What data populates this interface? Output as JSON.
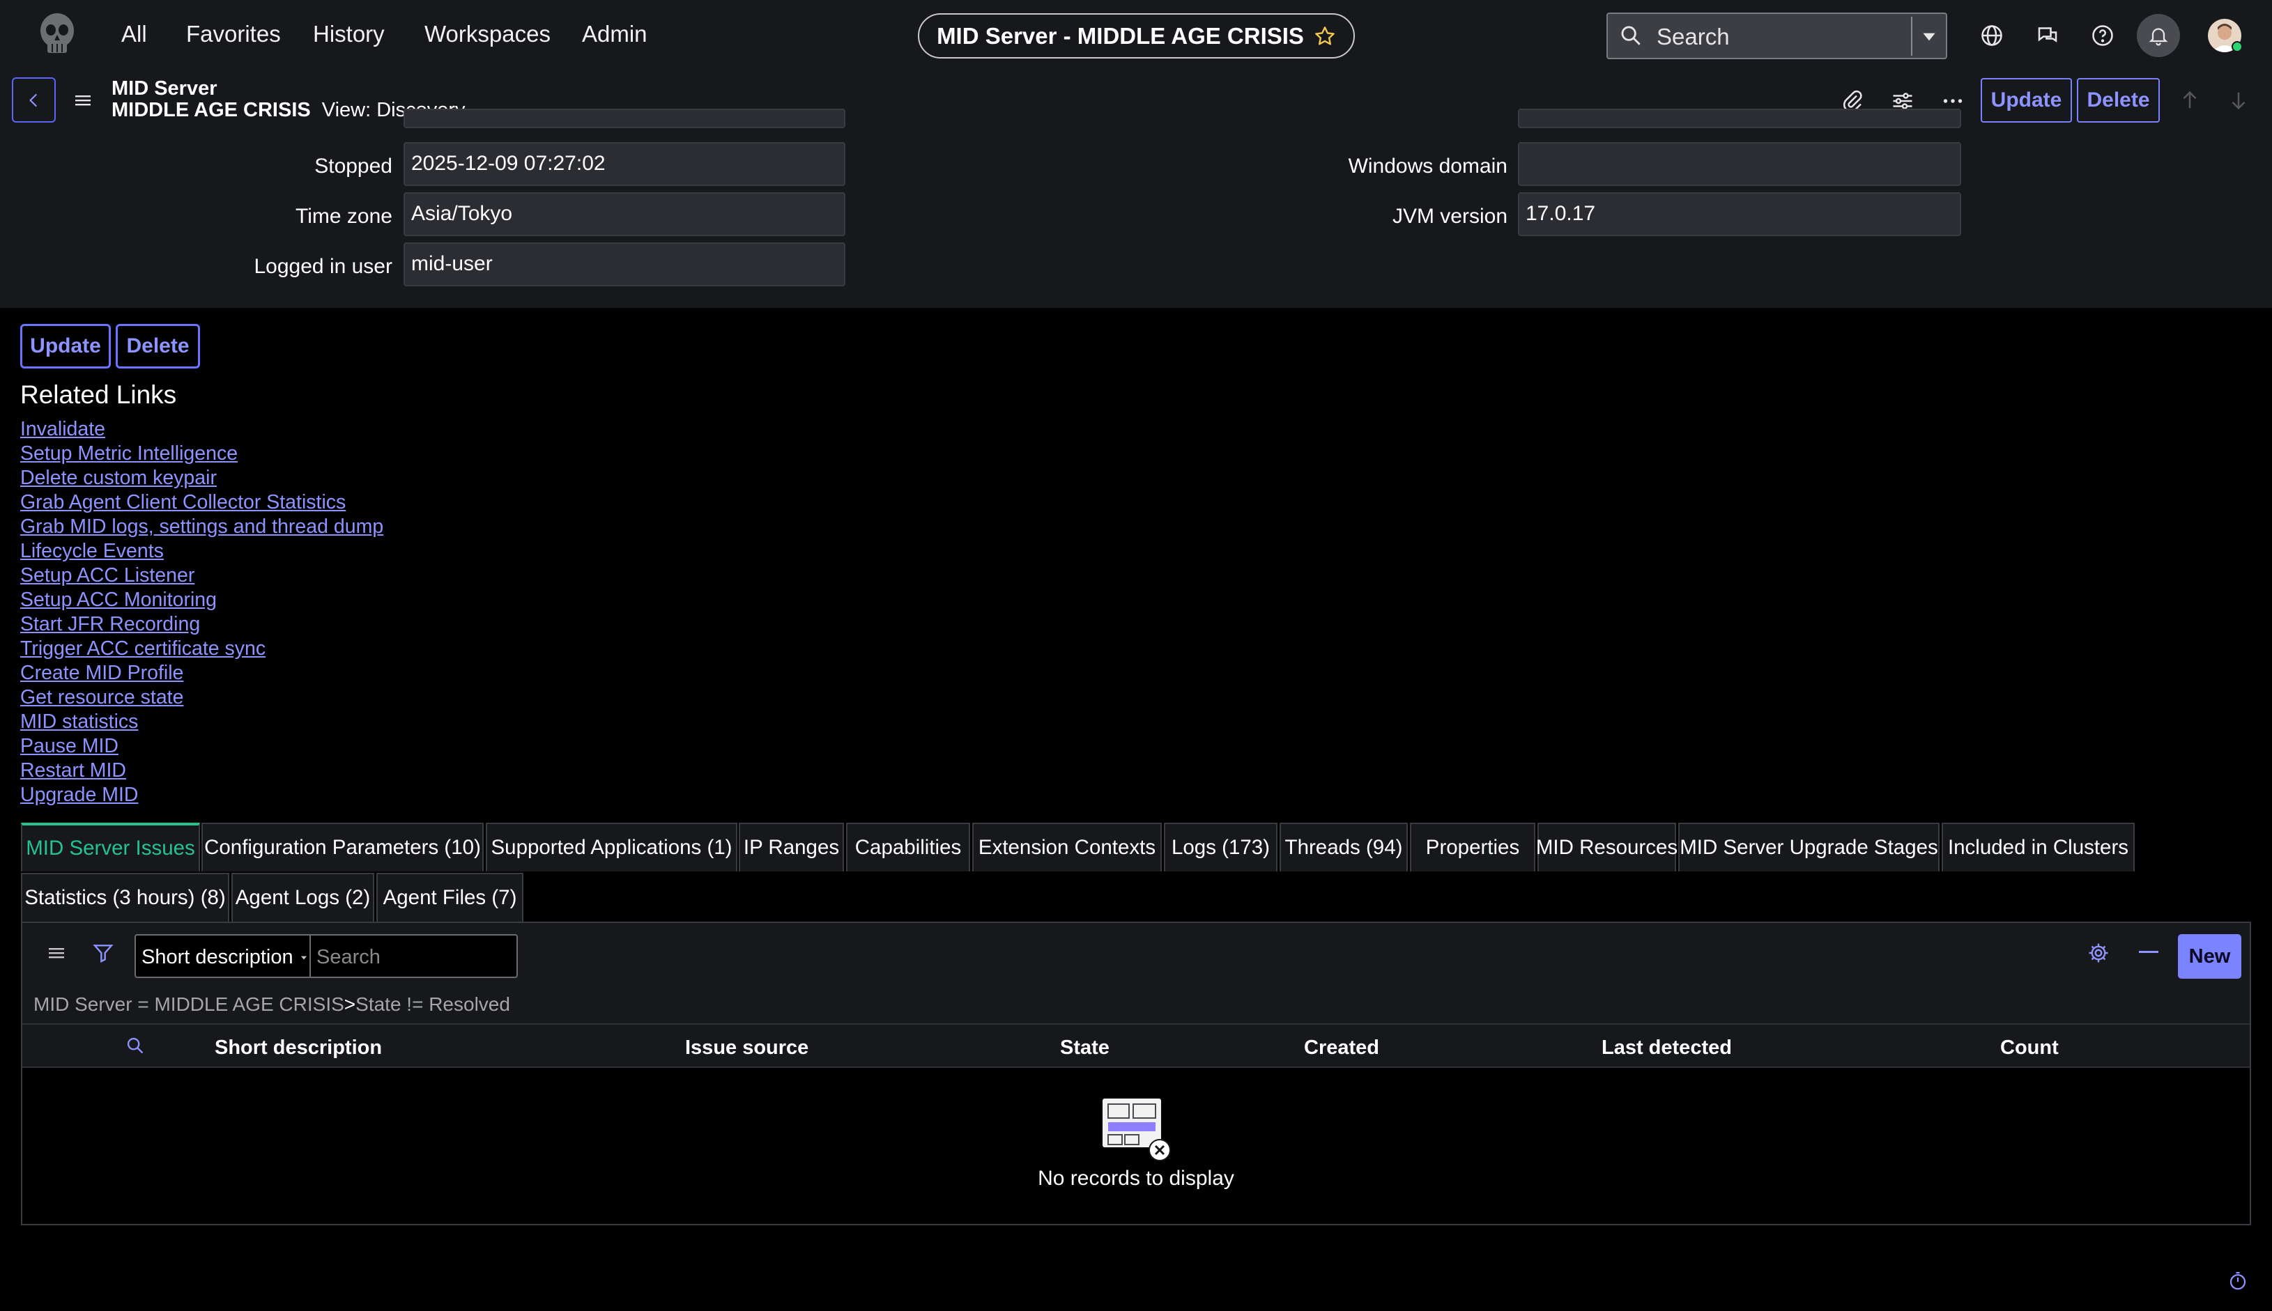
{
  "topnav": {
    "links": [
      "All",
      "Favorites",
      "History",
      "Workspaces",
      "Admin"
    ],
    "record_title": "MID Server - MIDDLE AGE CRISIS",
    "search_placeholder": "Search"
  },
  "form_header": {
    "table_name": "MID Server",
    "record_name": "MIDDLE AGE CRISIS",
    "view_label": "View: Discovery",
    "update_label": "Update",
    "delete_label": "Delete"
  },
  "fields": {
    "stopped": {
      "label": "Stopped",
      "value": "2025-12-09 07:27:02"
    },
    "time_zone": {
      "label": "Time zone",
      "value": "Asia/Tokyo"
    },
    "logged_in_user": {
      "label": "Logged in user",
      "value": "mid-user"
    },
    "windows_domain": {
      "label": "Windows domain",
      "value": ""
    },
    "jvm_version": {
      "label": "JVM version",
      "value": "17.0.17"
    }
  },
  "form_buttons": {
    "update_label": "Update",
    "delete_label": "Delete"
  },
  "related_links": {
    "title": "Related Links",
    "items": [
      "Invalidate",
      "Setup Metric Intelligence",
      "Delete custom keypair",
      "Grab Agent Client Collector Statistics",
      "Grab MID logs, settings and thread dump",
      "Lifecycle Events",
      "Setup ACC Listener",
      "Setup ACC Monitoring",
      "Start JFR Recording",
      "Trigger ACC certificate sync",
      "Create MID Profile",
      "Get resource state",
      "MID statistics",
      "Pause MID",
      "Restart MID",
      "Upgrade MID"
    ]
  },
  "tabs": {
    "row1": [
      "MID Server Issues",
      "Configuration Parameters (10)",
      "Supported Applications (1)",
      "IP Ranges",
      "Capabilities",
      "Extension Contexts",
      "Logs (173)",
      "Threads (94)",
      "Properties",
      "MID Resources",
      "MID Server Upgrade Stages",
      "Included in Clusters"
    ],
    "row2": [
      "Statistics (3 hours) (8)",
      "Agent Logs (2)",
      "Agent Files (7)"
    ]
  },
  "related_list": {
    "search_field": "Short description",
    "search_placeholder": "Search",
    "new_label": "New",
    "filter_text": "MID Server = MIDDLE AGE CRISIS",
    "filter_sep": ">",
    "filter_text2": "State != Resolved",
    "columns": [
      "Short description",
      "Issue source",
      "State",
      "Created",
      "Last detected",
      "Count"
    ],
    "empty_message": "No records to display"
  },
  "colors": {
    "accent": "#7a82ff",
    "active_tab": "#23c38e",
    "new_button": "#7b83ff"
  }
}
